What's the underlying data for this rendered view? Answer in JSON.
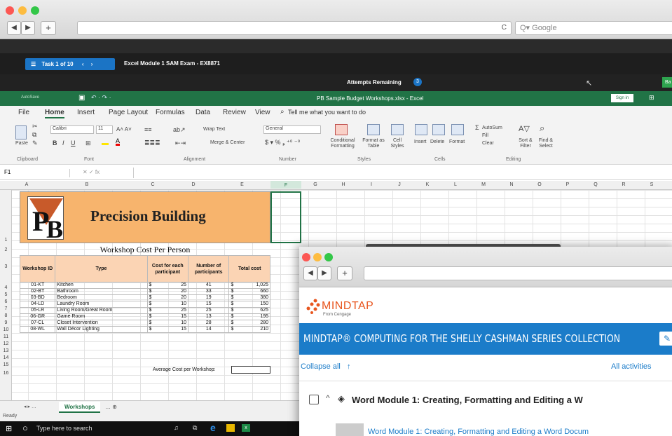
{
  "browser": {
    "back_icon": "back-arrow-icon",
    "forward_icon": "forward-arrow-icon",
    "new_tab_label": "+",
    "reload_label": "C",
    "search_placeholder": "Q▾ Google"
  },
  "sam": {
    "task_label": "Task 1 of 10",
    "exam_title": "Excel Module 1 SAM Exam - EX8871",
    "attempts_label": "Attempts Remaining",
    "attempts_count": "3",
    "right_button": "Ba"
  },
  "excel": {
    "autosave": "AutoSave",
    "file_title": "PB Sample Budget Workshops.xlsx - Excel",
    "sign_in": "Sign in",
    "tabs": [
      "File",
      "Home",
      "Insert",
      "Page Layout",
      "Formulas",
      "Data",
      "Review",
      "View",
      "Tell me what you want to do"
    ],
    "active_tab": "Home",
    "ribbon": {
      "font_name": "Calibri",
      "font_size": "11",
      "wrap_text": "Wrap Text",
      "merge_center": "Merge & Center",
      "number_format": "General",
      "conditional_formatting": "Conditional Formatting",
      "format_as_table": "Format as Table",
      "cell_styles": "Cell Styles",
      "insert": "Insert",
      "delete": "Delete",
      "format": "Format",
      "autosum": "AutoSum",
      "fill": "Fill",
      "clear": "Clear",
      "sort_filter": "Sort & Filter",
      "find_select": "Find & Select",
      "paste": "Paste",
      "groups": [
        "Clipboard",
        "Font",
        "Alignment",
        "Number",
        "Styles",
        "Cells",
        "Editing"
      ]
    },
    "name_box": "F1",
    "columns": [
      "A",
      "B",
      "C",
      "D",
      "E",
      "F",
      "G",
      "H",
      "I",
      "J",
      "K",
      "L",
      "M",
      "N",
      "O",
      "P",
      "Q",
      "R",
      "S"
    ],
    "rows": [
      "1",
      "2",
      "3",
      "4",
      "5",
      "6",
      "7",
      "8",
      "9",
      "10",
      "11",
      "12",
      "13",
      "14",
      "15",
      "16"
    ],
    "company_title": "Precision Building",
    "logo_letters": "PB",
    "subtitle": "Workshop Cost Per Person",
    "headers": [
      "Workshop ID",
      "Type",
      "Cost for each participant",
      "Number of participants",
      "Total cost"
    ],
    "table_rows": [
      [
        "01-KT",
        "Kitchen",
        "$",
        "25",
        "41",
        "$",
        "1,025"
      ],
      [
        "02-BT",
        "Bathroom",
        "$",
        "20",
        "33",
        "$",
        "660"
      ],
      [
        "03-BD",
        "Bedroom",
        "$",
        "20",
        "19",
        "$",
        "380"
      ],
      [
        "04-LD",
        "Laundry Room",
        "$",
        "10",
        "15",
        "$",
        "150"
      ],
      [
        "05-LR",
        "Living Room/Great Room",
        "$",
        "25",
        "25",
        "$",
        "625"
      ],
      [
        "06-GR",
        "Game Room",
        "$",
        "15",
        "13",
        "$",
        "195"
      ],
      [
        "07-CL",
        "Closet Intervention",
        "$",
        "10",
        "28",
        "$",
        "280"
      ],
      [
        "08-WL",
        "Wall Décor Lighting",
        "$",
        "15",
        "14",
        "$",
        "210"
      ]
    ],
    "average_label": "Average Cost per Workshop:",
    "sheet_tab": "Workshops",
    "status": "Ready"
  },
  "taskbar": {
    "search_text": "Type here to search"
  },
  "mindtap": {
    "logo": "MINDTAP",
    "logo_sub": "From Cengage",
    "banner": "MINDTAP® COMPUTING FOR THE SHELLY CASHMAN SERIES COLLECTION",
    "collapse_all": "Collapse all",
    "all_activities": "All activities",
    "module_title": "Word Module 1: Creating, Formatting and Editing a W",
    "sub_item": "Word Module 1: Creating, Formatting and Editing a Word Docum"
  },
  "colors": {
    "excel_green": "#217346",
    "orange_fill": "#f7b46d",
    "header_fill": "#fbd4b4",
    "mindtap_blue": "#1b7cc9",
    "mindtap_orange": "#e8561f"
  }
}
